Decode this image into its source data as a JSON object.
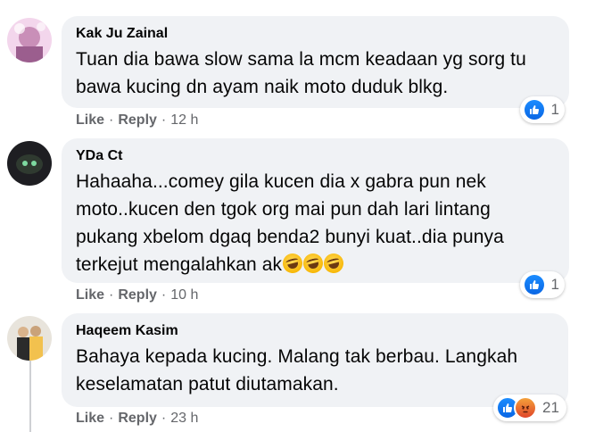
{
  "comments": [
    {
      "author": "Kak Ju Zainal",
      "lines": [
        "Tuan dia bawa slow sama la mcm keadaan yg sorg tu",
        "bawa kucing dn ayam naik moto duduk blkg."
      ],
      "like_label": "Like",
      "reply_label": "Reply",
      "time": "12 h",
      "reaction_count": "1",
      "reactions": [
        "like"
      ]
    },
    {
      "author": "YDa Ct",
      "lines": [
        "Hahaaha...comey gila kucen dia x gabra pun nek",
        "moto..kucen den tgok org mai pun dah lari lintang",
        "pukang xbelom dgaq benda2 bunyi kuat..dia punya",
        "terkejut mengalahkan ak"
      ],
      "emoji_icon": "rolling-on-floor-laughing-emoji",
      "like_label": "Like",
      "reply_label": "Reply",
      "time": "10 h",
      "reaction_count": "1",
      "reactions": [
        "like"
      ]
    },
    {
      "author": "Haqeem Kasim",
      "lines": [
        "Bahaya kepada kucing. Malang tak berbau. Langkah",
        "keselamatan patut diutamakan."
      ],
      "like_label": "Like",
      "reply_label": "Reply",
      "time": "23 h",
      "reaction_count": "21",
      "reactions": [
        "like",
        "angry"
      ]
    }
  ],
  "colors": {
    "bubble": "#f0f2f5",
    "meta": "#65676b",
    "like_blue": "#1877f2",
    "angry": "#e9710f"
  }
}
